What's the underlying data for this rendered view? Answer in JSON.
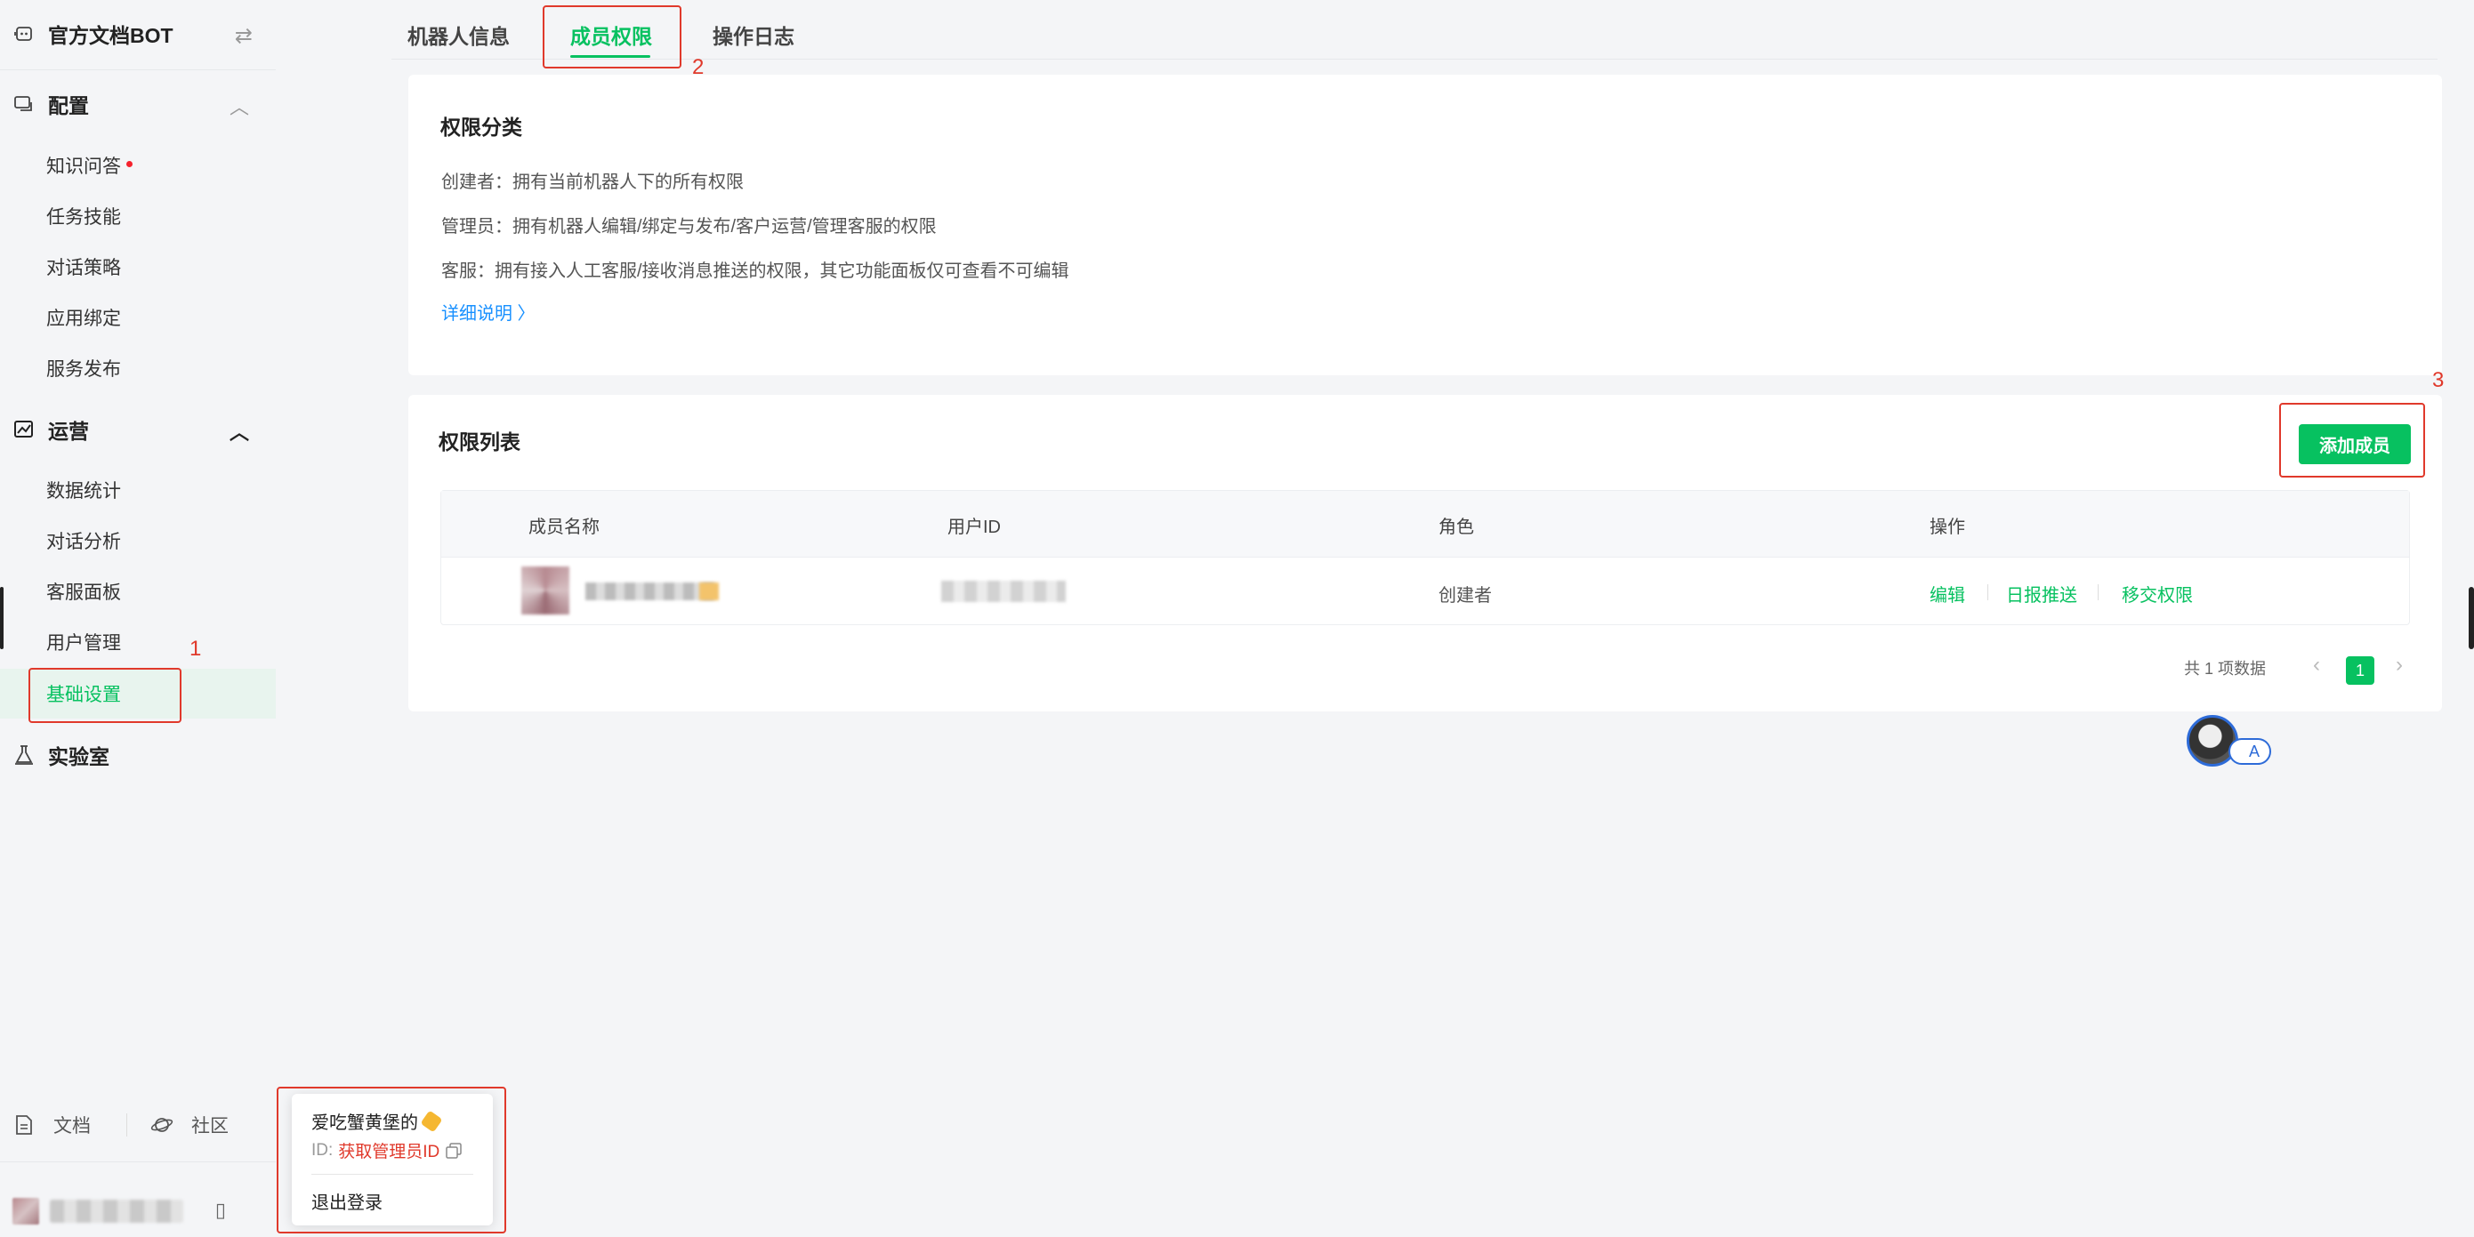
{
  "sidebar": {
    "bot_name": "官方文档BOT",
    "config_section": "配置",
    "config_items": [
      "知识问答",
      "任务技能",
      "对话策略",
      "应用绑定",
      "服务发布"
    ],
    "ops_section": "运营",
    "ops_items": [
      "数据统计",
      "对话分析",
      "客服面板",
      "用户管理",
      "基础设置"
    ],
    "lab_section": "实验室",
    "footer": {
      "docs": "文档",
      "community": "社区"
    }
  },
  "popover": {
    "username": "爱吃蟹黄堡的",
    "id_label": "ID:",
    "id_link": "获取管理员ID",
    "logout": "退出登录"
  },
  "tabs": [
    "机器人信息",
    "成员权限",
    "操作日志"
  ],
  "permission_card": {
    "title": "权限分类",
    "lines": [
      "创建者：拥有当前机器人下的所有权限",
      "管理员：拥有机器人编辑/绑定与发布/客户运营/管理客服的权限",
      "客服：拥有接入人工客服/接收消息推送的权限，其它功能面板仅可查看不可编辑"
    ],
    "detail_link": "详细说明 〉"
  },
  "list_card": {
    "title": "权限列表",
    "add_button": "添加成员",
    "columns": [
      "成员名称",
      "用户ID",
      "角色",
      "操作"
    ],
    "rows": [
      {
        "role": "创建者",
        "actions": [
          "编辑",
          "日报推送",
          "移交权限"
        ]
      }
    ],
    "total": "共 1 项数据",
    "current_page": "1"
  },
  "annotations": [
    "1",
    "2",
    "3"
  ],
  "float_chip": "A",
  "colors": {
    "accent": "#07c160",
    "highlight": "#e0392b",
    "link": "#1890ff"
  }
}
